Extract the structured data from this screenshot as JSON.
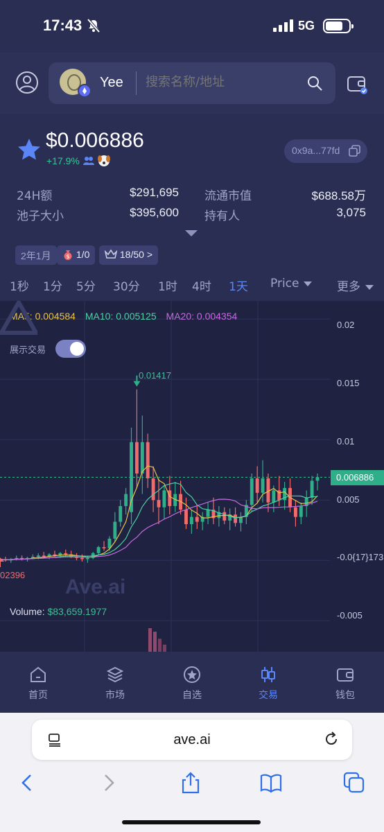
{
  "status_bar": {
    "time": "17:43",
    "network": "5G"
  },
  "header": {
    "user_name": "Yee",
    "search_placeholder": "搜索名称/地址"
  },
  "token": {
    "price": "$0.006886",
    "change": "+17.9%",
    "address": "0x9a...77fd",
    "stats": [
      {
        "label": "24H额",
        "value": "$291,695"
      },
      {
        "label": "流通市值",
        "value": "$688.58万"
      },
      {
        "label": "池子大小",
        "value": "$395,600"
      },
      {
        "label": "持有人",
        "value": "3,075"
      }
    ],
    "tags": {
      "age": "2年1月",
      "tax": "1/0",
      "audit": "18/50 >"
    }
  },
  "timeframes": [
    {
      "label": "1秒",
      "active": false
    },
    {
      "label": "1分",
      "active": false
    },
    {
      "label": "5分",
      "active": false
    },
    {
      "label": "30分",
      "active": false
    },
    {
      "label": "1时",
      "active": false
    },
    {
      "label": "4时",
      "active": false
    },
    {
      "label": "1天",
      "active": true
    }
  ],
  "chart_controls": {
    "price_mode": "Price",
    "more": "更多",
    "show_trades_label": "展示交易",
    "show_trades": true
  },
  "chart_data": {
    "type": "candlestick",
    "interval": "1天",
    "ma": [
      {
        "name": "MA5",
        "value": "0.004584",
        "color": "#e8c547"
      },
      {
        "name": "MA10",
        "value": "0.005125",
        "color": "#4fd1a5"
      },
      {
        "name": "MA20",
        "value": "0.004354",
        "color": "#c46be0"
      }
    ],
    "y_ticks": [
      "0.02",
      "0.015",
      "0.01",
      "0.005",
      "-0.0{17}173",
      "-0.005"
    ],
    "ylim": [
      -0.0055,
      0.0215
    ],
    "current_price": "0.006886",
    "current_price_value": 0.006886,
    "peak_label": "0.01417",
    "low_label": "02396",
    "volume": "$83,659.1977",
    "watermark": "Ave.ai",
    "candles": [
      {
        "o": 0.0,
        "h": 0.0002,
        "l": -0.0002,
        "c": 0.0001
      },
      {
        "o": 0.0001,
        "h": 0.0003,
        "l": -0.0001,
        "c": 0.0
      },
      {
        "o": 0.0,
        "h": 0.0002,
        "l": -0.0002,
        "c": 0.0001
      },
      {
        "o": 0.0001,
        "h": 0.0004,
        "l": 0.0,
        "c": 0.0002
      },
      {
        "o": 0.0002,
        "h": 0.0004,
        "l": 0.0,
        "c": 0.0001
      },
      {
        "o": 0.0001,
        "h": 0.0003,
        "l": -0.0001,
        "c": 0.0002
      },
      {
        "o": 0.0002,
        "h": 0.0005,
        "l": 0.0001,
        "c": 0.0003
      },
      {
        "o": 0.0003,
        "h": 0.0006,
        "l": 0.0001,
        "c": 0.0004
      },
      {
        "o": 0.0004,
        "h": 0.0007,
        "l": 0.0002,
        "c": 0.0003
      },
      {
        "o": 0.0003,
        "h": 0.0006,
        "l": 0.0001,
        "c": 0.0005
      },
      {
        "o": 0.0005,
        "h": 0.0008,
        "l": 0.0003,
        "c": 0.0004
      },
      {
        "o": 0.0004,
        "h": 0.0007,
        "l": 0.0002,
        "c": 0.0006
      },
      {
        "o": 0.0006,
        "h": 0.0009,
        "l": 0.0003,
        "c": 0.0005
      },
      {
        "o": 0.0005,
        "h": 0.0008,
        "l": 0.0002,
        "c": 0.0003
      },
      {
        "o": 0.0003,
        "h": 0.0006,
        "l": 0.0,
        "c": 0.0002
      },
      {
        "o": 0.0002,
        "h": 0.0005,
        "l": -0.0001,
        "c": 0.0001
      },
      {
        "o": 0.0001,
        "h": 0.0004,
        "l": -0.0002,
        "c": 0.0002
      },
      {
        "o": 0.0002,
        "h": 0.0007,
        "l": 0.0001,
        "c": 0.0006
      },
      {
        "o": 0.0006,
        "h": 0.0012,
        "l": 0.0004,
        "c": 0.0011
      },
      {
        "o": 0.0011,
        "h": 0.0016,
        "l": 0.0008,
        "c": 0.001
      },
      {
        "o": 0.001,
        "h": 0.002,
        "l": 0.0008,
        "c": 0.0018
      },
      {
        "o": 0.0018,
        "h": 0.004,
        "l": 0.0015,
        "c": 0.0032
      },
      {
        "o": 0.0032,
        "h": 0.005,
        "l": 0.0028,
        "c": 0.0045
      },
      {
        "o": 0.0045,
        "h": 0.006,
        "l": 0.0038,
        "c": 0.0055
      },
      {
        "o": 0.004,
        "h": 0.011,
        "l": 0.003,
        "c": 0.0098
      },
      {
        "o": 0.0098,
        "h": 0.01417,
        "l": 0.006,
        "c": 0.0072
      },
      {
        "o": 0.0072,
        "h": 0.012,
        "l": 0.0055,
        "c": 0.0098
      },
      {
        "o": 0.0098,
        "h": 0.0105,
        "l": 0.006,
        "c": 0.0068
      },
      {
        "o": 0.0068,
        "h": 0.0078,
        "l": 0.004,
        "c": 0.005
      },
      {
        "o": 0.005,
        "h": 0.0068,
        "l": 0.003,
        "c": 0.0044
      },
      {
        "o": 0.0044,
        "h": 0.0062,
        "l": 0.0034,
        "c": 0.0058
      },
      {
        "o": 0.0058,
        "h": 0.007,
        "l": 0.0038,
        "c": 0.0045
      },
      {
        "o": 0.0045,
        "h": 0.0065,
        "l": 0.004,
        "c": 0.0055
      },
      {
        "o": 0.0055,
        "h": 0.0066,
        "l": 0.0038,
        "c": 0.0042
      },
      {
        "o": 0.0042,
        "h": 0.0052,
        "l": 0.0026,
        "c": 0.003
      },
      {
        "o": 0.003,
        "h": 0.0042,
        "l": 0.0022,
        "c": 0.0036
      },
      {
        "o": 0.0036,
        "h": 0.0046,
        "l": 0.0026,
        "c": 0.0032
      },
      {
        "o": 0.0032,
        "h": 0.004,
        "l": 0.0025,
        "c": 0.0036
      },
      {
        "o": 0.0036,
        "h": 0.0048,
        "l": 0.003,
        "c": 0.0042
      },
      {
        "o": 0.0042,
        "h": 0.0052,
        "l": 0.003,
        "c": 0.0035
      },
      {
        "o": 0.0035,
        "h": 0.0045,
        "l": 0.0028,
        "c": 0.004
      },
      {
        "o": 0.004,
        "h": 0.0044,
        "l": 0.003,
        "c": 0.0033
      },
      {
        "o": 0.0033,
        "h": 0.0043,
        "l": 0.0025,
        "c": 0.0038
      },
      {
        "o": 0.0038,
        "h": 0.0044,
        "l": 0.0028,
        "c": 0.0031
      },
      {
        "o": 0.0031,
        "h": 0.004,
        "l": 0.0024,
        "c": 0.0036
      },
      {
        "o": 0.0036,
        "h": 0.005,
        "l": 0.003,
        "c": 0.0046
      },
      {
        "o": 0.0046,
        "h": 0.0072,
        "l": 0.004,
        "c": 0.0068
      },
      {
        "o": 0.0068,
        "h": 0.0078,
        "l": 0.0048,
        "c": 0.0056
      },
      {
        "o": 0.0056,
        "h": 0.0083,
        "l": 0.0048,
        "c": 0.0068
      },
      {
        "o": 0.0068,
        "h": 0.0072,
        "l": 0.004,
        "c": 0.0048
      },
      {
        "o": 0.0048,
        "h": 0.0062,
        "l": 0.004,
        "c": 0.0058
      },
      {
        "o": 0.0058,
        "h": 0.007,
        "l": 0.0045,
        "c": 0.005
      },
      {
        "o": 0.005,
        "h": 0.0065,
        "l": 0.0042,
        "c": 0.006
      },
      {
        "o": 0.006,
        "h": 0.0068,
        "l": 0.004,
        "c": 0.0044
      },
      {
        "o": 0.0044,
        "h": 0.005,
        "l": 0.0028,
        "c": 0.0036
      },
      {
        "o": 0.0036,
        "h": 0.0048,
        "l": 0.003,
        "c": 0.0045
      },
      {
        "o": 0.0045,
        "h": 0.0058,
        "l": 0.0036,
        "c": 0.0052
      },
      {
        "o": 0.0052,
        "h": 0.007,
        "l": 0.0046,
        "c": 0.0066
      },
      {
        "o": 0.0066,
        "h": 0.0072,
        "l": 0.0058,
        "c": 0.0069
      }
    ],
    "volumes": [
      {
        "v": 1.0,
        "up": false
      },
      {
        "v": 0.85,
        "up": false
      },
      {
        "v": 0.55,
        "up": false
      },
      {
        "v": 0.3,
        "up": false
      }
    ]
  },
  "tabbar": [
    {
      "label": "首页",
      "icon": "home-icon",
      "active": false
    },
    {
      "label": "市场",
      "icon": "layers-icon",
      "active": false
    },
    {
      "label": "自选",
      "icon": "star-circle-icon",
      "active": false
    },
    {
      "label": "交易",
      "icon": "candles-icon",
      "active": true
    },
    {
      "label": "钱包",
      "icon": "wallet-icon",
      "active": false
    }
  ],
  "browser": {
    "url": "ave.ai"
  },
  "colors": {
    "up": "#2fae8a",
    "down": "#f06b6b",
    "accent": "#5a86f7",
    "background": "#2a2e52",
    "chart_bg": "#1f2240"
  }
}
